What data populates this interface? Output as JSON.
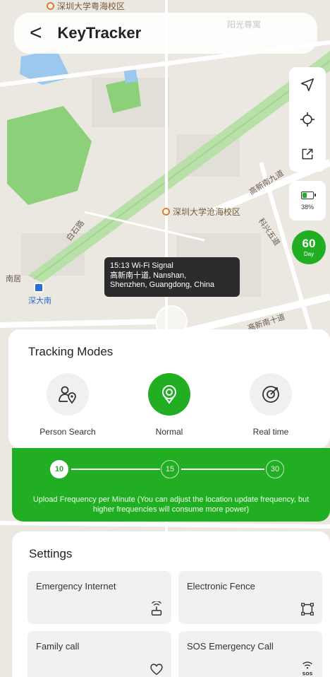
{
  "header": {
    "title": "KeyTracker",
    "back_glyph": "<",
    "faint_label": "阳光尊寓"
  },
  "map": {
    "poi_main": "深圳大学沧海校区",
    "poi_top": "深圳大学粤海校区",
    "station": "深大南",
    "roads": {
      "baishi": "白石路",
      "gaoxin_9": "高新南九道",
      "gaoxin_10": "高新南十道",
      "kexing": "科兴五道",
      "left_label": "南居"
    }
  },
  "controls": {
    "navigate_icon": "navigation-arrow-icon",
    "locate_icon": "crosshair-icon",
    "share_icon": "external-share-icon",
    "battery_percent": "38%",
    "battery_level": 0.38,
    "day_number": "60",
    "day_label": "Day"
  },
  "popup": {
    "line1": "15:13 Wi-Fi Signal",
    "line2": "高新南十道, Nanshan,",
    "line3": "Shenzhen, Guangdong, China"
  },
  "tracking": {
    "title": "Tracking Modes",
    "modes": [
      {
        "label": "Person Search",
        "icon": "person-search-icon",
        "active": false
      },
      {
        "label": "Normal",
        "icon": "normal-location-icon",
        "active": true
      },
      {
        "label": "Real time",
        "icon": "realtime-target-icon",
        "active": false
      }
    ]
  },
  "frequency": {
    "stops": [
      "10",
      "15",
      "30"
    ],
    "selected": "10",
    "note": "Upload Frequency per Minute (You can adjust the location update frequency, but higher frequencies will consume more power)"
  },
  "settings": {
    "title": "Settings",
    "items": [
      {
        "label": "Emergency Internet",
        "icon": "wifi-router-icon"
      },
      {
        "label": "Electronic Fence",
        "icon": "fence-square-icon"
      },
      {
        "label": "Family call",
        "icon": "heart-icon"
      },
      {
        "label": "SOS Emergency Call",
        "icon": "sos-signal-icon"
      }
    ]
  },
  "colors": {
    "accent_green": "#22ae22",
    "map_green": "#8cd07a",
    "water": "#9cc8f0",
    "popup_bg": "#2b2b2b"
  }
}
